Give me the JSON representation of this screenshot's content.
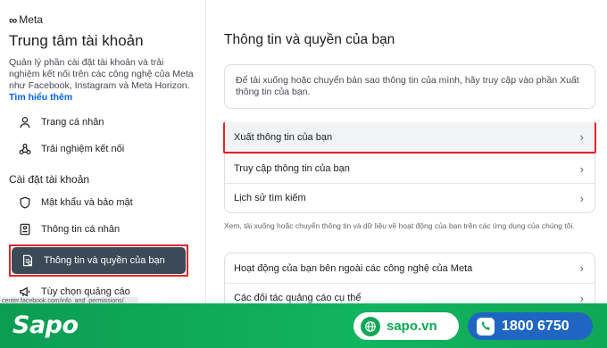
{
  "sidebar": {
    "brand": "Meta",
    "title": "Trung tâm tài khoản",
    "description": "Quản lý phần cài đặt tài khoản và trải nghiệm kết nối trên các công nghệ của Meta như Facebook, Instagram và Meta Horizon.",
    "learn_more": "Tìm hiểu thêm",
    "top_items": [
      {
        "label": "Trang cá nhân",
        "icon": "person-icon"
      },
      {
        "label": "Trải nghiệm kết nối",
        "icon": "connected-experiences-icon"
      }
    ],
    "section_label": "Cài đặt tài khoản",
    "settings_items": [
      {
        "label": "Mật khẩu và bảo mật",
        "icon": "shield-icon"
      },
      {
        "label": "Thông tin cá nhân",
        "icon": "id-card-icon"
      },
      {
        "label": "Thông tin và quyền của bạn",
        "icon": "info-document-icon",
        "active": true
      },
      {
        "label": "Tùy chọn quảng cáo",
        "icon": "megaphone-icon"
      }
    ],
    "url_tooltip": "center.facebook.com/info_and_permissions/"
  },
  "main": {
    "title": "Thông tin và quyền của bạn",
    "info_text": "Để tải xuống hoặc chuyển bản sao thông tin của mình, hãy truy cập vào phần Xuất thông tin của bạn.",
    "rows": [
      {
        "label": "Xuất thông tin của bạn",
        "highlighted": true
      },
      {
        "label": "Truy cập thông tin của bạn"
      },
      {
        "label": "Lịch sử tìm kiếm"
      }
    ],
    "note": "Xem, tải xuống hoặc chuyển thông tin và dữ liệu về hoạt động của bạn trên các ứng dụng của chúng tôi.",
    "rows2": [
      {
        "label": "Hoạt động của bạn bên ngoài các công nghệ của Meta"
      },
      {
        "label": "Các đối tác quảng cáo cụ thể"
      }
    ]
  },
  "banner": {
    "logo": "Sapo",
    "website": "sapo.vn",
    "phone": "1800 6750",
    "colors": {
      "green": "#0fa858",
      "blue": "#1f66c2"
    }
  }
}
